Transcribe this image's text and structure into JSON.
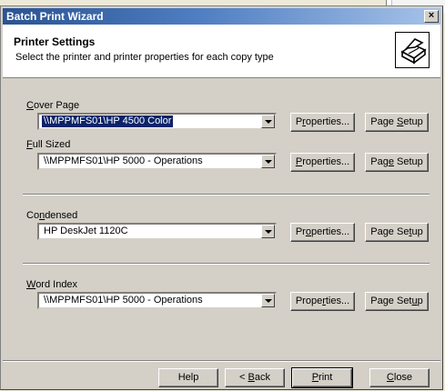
{
  "window": {
    "title": "Batch Print Wizard",
    "close_label": "×"
  },
  "header": {
    "title": "Printer Settings",
    "subtitle": "Select the printer and printer properties for each copy type",
    "icon": "printer-icon"
  },
  "sections": [
    {
      "label_pre": "",
      "label_key": "C",
      "label_post": "over Page",
      "printer": "\\\\MPPMFS01\\HP 4500 Color",
      "selected": true,
      "properties_pre": "P",
      "properties_key": "r",
      "properties_post": "operties...",
      "setup_pre": "Page ",
      "setup_key": "S",
      "setup_post": "etup"
    },
    {
      "label_pre": "",
      "label_key": "F",
      "label_post": "ull Sized",
      "printer": "\\\\MPPMFS01\\HP 5000 - Operations",
      "selected": false,
      "properties_pre": "",
      "properties_key": "P",
      "properties_post": "roperties...",
      "setup_pre": "Pag",
      "setup_key": "e",
      "setup_post": " Setup"
    },
    {
      "label_pre": "Co",
      "label_key": "n",
      "label_post": "densed",
      "printer": "HP DeskJet 1120C",
      "selected": false,
      "properties_pre": "Pr",
      "properties_key": "o",
      "properties_post": "perties...",
      "setup_pre": "Page Se",
      "setup_key": "t",
      "setup_post": "up"
    },
    {
      "label_pre": "",
      "label_key": "W",
      "label_post": "ord Index",
      "printer": "\\\\MPPMFS01\\HP 5000 - Operations",
      "selected": false,
      "properties_pre": "Prope",
      "properties_key": "r",
      "properties_post": "ties...",
      "setup_pre": "Page Set",
      "setup_key": "u",
      "setup_post": "p"
    }
  ],
  "footer": {
    "help": "Help",
    "back_pre": "< ",
    "back_key": "B",
    "back_post": "ack",
    "print_key": "P",
    "print_post": "rint",
    "close_key": "C",
    "close_post": "lose"
  },
  "colors": {
    "title_bar_start": "#2a5392",
    "title_bar_end": "#a7c3e9",
    "dialog_face": "#d4d0c8",
    "selection": "#0a246a"
  }
}
